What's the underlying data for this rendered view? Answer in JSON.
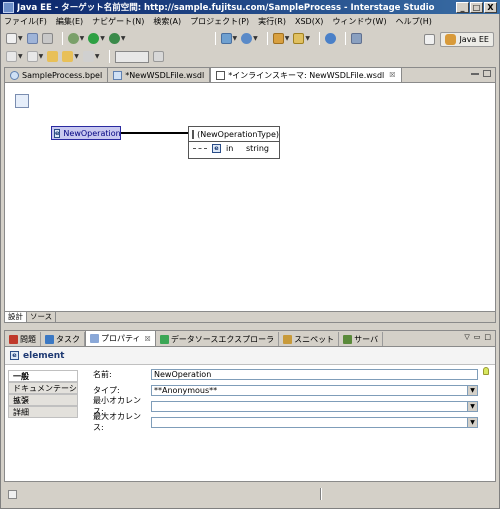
{
  "window": {
    "title": "Java EE - ターゲット名前空間: http://sample.fujitsu.com/SampleProcess - Interstage Studio",
    "controls": [
      "_",
      "□",
      "X"
    ]
  },
  "menu": [
    "ファイル(F)",
    "編集(E)",
    "ナビゲート(N)",
    "検索(A)",
    "プロジェクト(P)",
    "実行(R)",
    "XSD(X)",
    "ウィンドウ(W)",
    "ヘルプ(H)"
  ],
  "perspective": {
    "label": "Java EE"
  },
  "editor": {
    "tabs": [
      {
        "label": "SampleProcess.bpel",
        "active": false
      },
      {
        "label": "*NewWSDLFile.wsdl",
        "active": false
      },
      {
        "label": "*インラインスキーマ: NewWSDLFile.wsdl",
        "active": true,
        "close": "☒"
      }
    ],
    "diagram": {
      "operation": {
        "badge": "e",
        "label": "NewOperation"
      },
      "complex_type": {
        "label": "(NewOperationType)",
        "element": {
          "badge": "e",
          "name": "in",
          "type": "string"
        }
      }
    },
    "bottom_tabs": [
      "設計",
      "ソース"
    ]
  },
  "views": {
    "tabs": [
      {
        "label": "問題",
        "icon_color": "#c0392b"
      },
      {
        "label": "タスク",
        "icon_color": "#3b78c3"
      },
      {
        "label": "プロパティ",
        "icon_color": "#8aa8d8",
        "active": true,
        "close": "☒"
      },
      {
        "label": "データソースエクスプローラ",
        "icon_color": "#3aa655"
      },
      {
        "label": "スニペット",
        "icon_color": "#c89a3a"
      },
      {
        "label": "サーバ",
        "icon_color": "#5a8a3a"
      }
    ],
    "properties": {
      "header": {
        "badge": "e",
        "title": "element"
      },
      "categories": [
        "一般",
        "ドキュメンテーション",
        "拡張",
        "詳細"
      ],
      "fields": [
        {
          "label": "名前:",
          "value": "NewOperation",
          "type": "text"
        },
        {
          "label": "タイプ:",
          "value": "**Anonymous**",
          "type": "combo"
        },
        {
          "label": "最小オカレンス:",
          "value": "",
          "type": "combo"
        },
        {
          "label": "最大オカレンス:",
          "value": "",
          "type": "combo"
        }
      ]
    }
  }
}
